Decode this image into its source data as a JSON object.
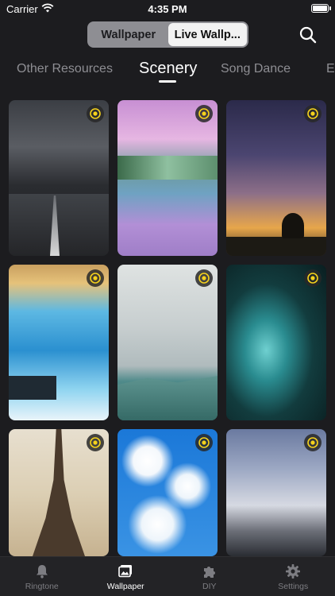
{
  "status_bar": {
    "carrier": "Carrier",
    "time": "4:35 PM"
  },
  "header": {
    "segments": [
      {
        "label": "Wallpaper",
        "active": false
      },
      {
        "label": "Live Wallp...",
        "active": true
      }
    ],
    "search_icon": "search-icon"
  },
  "categories": {
    "items": [
      "Other Resources",
      "Scenery",
      "Song Dance",
      "E"
    ],
    "active": "Scenery"
  },
  "wallpapers": [
    {
      "scene": "rainy road",
      "live_badge": true
    },
    {
      "scene": "cherry blossom lake",
      "live_badge": true
    },
    {
      "scene": "milky way sunset",
      "live_badge": true
    },
    {
      "scene": "blue ice",
      "live_badge": true
    },
    {
      "scene": "cloudy mountains",
      "live_badge": true
    },
    {
      "scene": "aerial coast",
      "live_badge": true
    },
    {
      "scene": "eiffel tower",
      "live_badge": true
    },
    {
      "scene": "blue sky clouds",
      "live_badge": true
    },
    {
      "scene": "sea of clouds",
      "live_badge": true
    }
  ],
  "tab_bar": {
    "items": [
      {
        "label": "Ringtone",
        "icon": "bell-icon",
        "active": false
      },
      {
        "label": "Wallpaper",
        "icon": "image-icon",
        "active": true
      },
      {
        "label": "DIY",
        "icon": "puzzle-icon",
        "active": false
      },
      {
        "label": "Settings",
        "icon": "gear-icon",
        "active": false
      }
    ]
  },
  "colors": {
    "background": "#1c1c1f",
    "badge_accent": "#f5d21c",
    "tab_inactive": "#7d7d82"
  }
}
